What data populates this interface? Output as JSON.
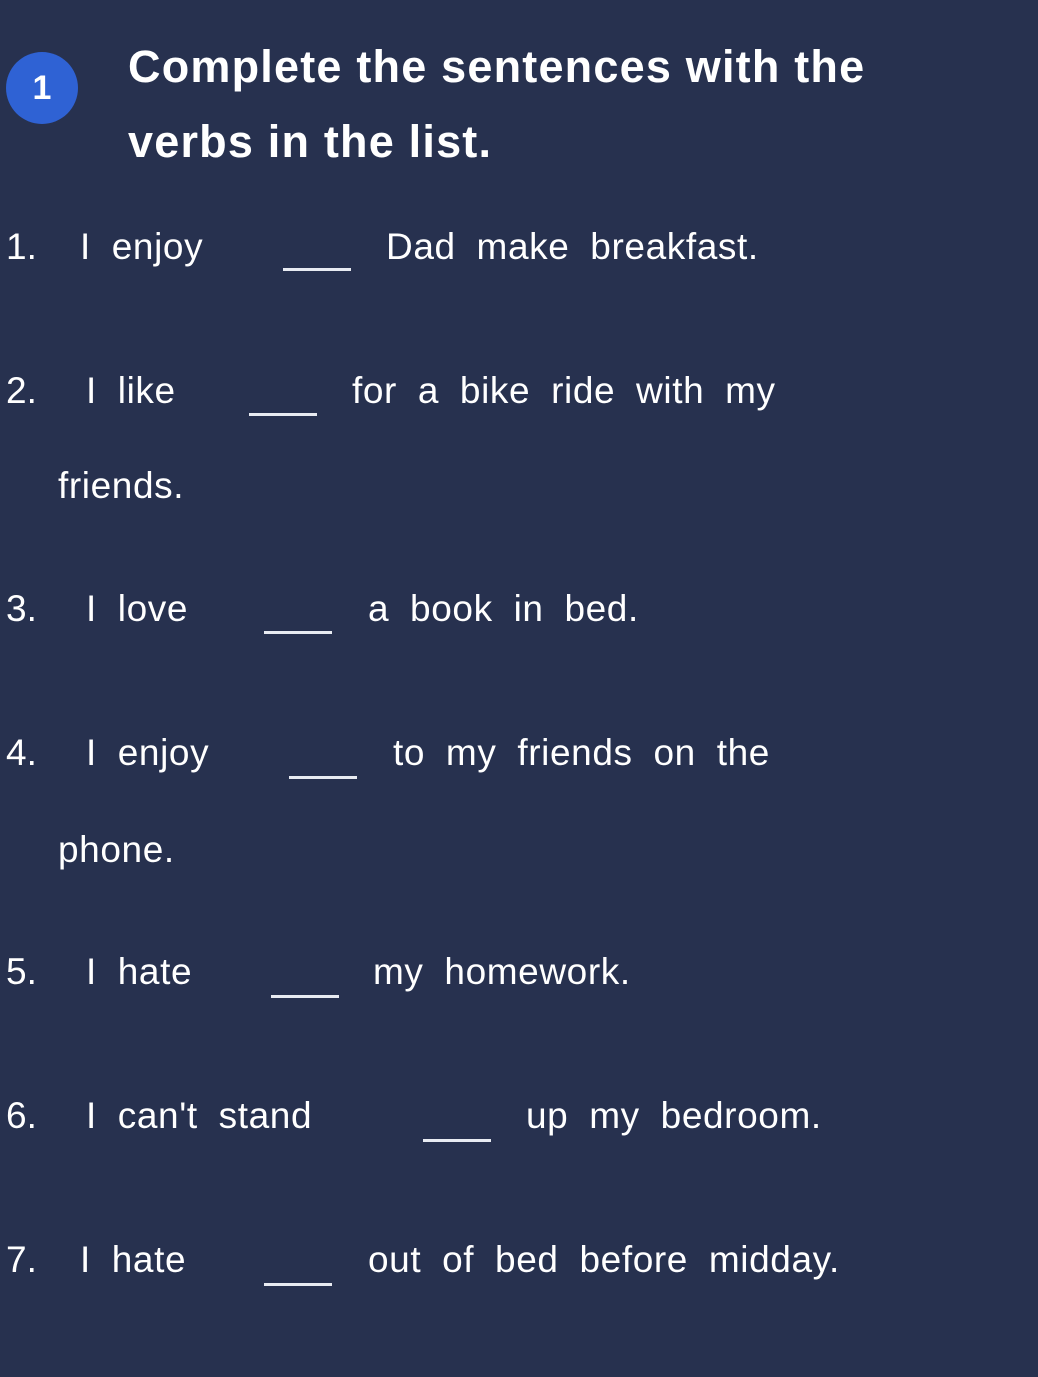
{
  "exercise": {
    "number": "1",
    "badge_color": "#2f62d4",
    "background_color": "#27314f",
    "title_line1": "Complete the sentences with the",
    "title_line2": "verbs in the list."
  },
  "sentences": [
    {
      "number": "1.",
      "before": "I enjoy",
      "after": "Dad make breakfast.",
      "continuation": "",
      "answer": ""
    },
    {
      "number": "2.",
      "before": "I like",
      "after": "for a bike ride with my",
      "continuation": "friends.",
      "answer": ""
    },
    {
      "number": "3.",
      "before": "I love",
      "after": "a book in bed.",
      "continuation": "",
      "answer": ""
    },
    {
      "number": "4.",
      "before": "I enjoy",
      "after": "to my friends on the",
      "continuation": "phone.",
      "answer": ""
    },
    {
      "number": "5.",
      "before": "I hate",
      "after": "my homework.",
      "continuation": "",
      "answer": ""
    },
    {
      "number": "6.",
      "before": "I can't stand",
      "after": "up my bedroom.",
      "continuation": "",
      "answer": ""
    },
    {
      "number": "7.",
      "before": "I hate",
      "after": "out of bed before midday.",
      "continuation": "",
      "answer": ""
    }
  ]
}
